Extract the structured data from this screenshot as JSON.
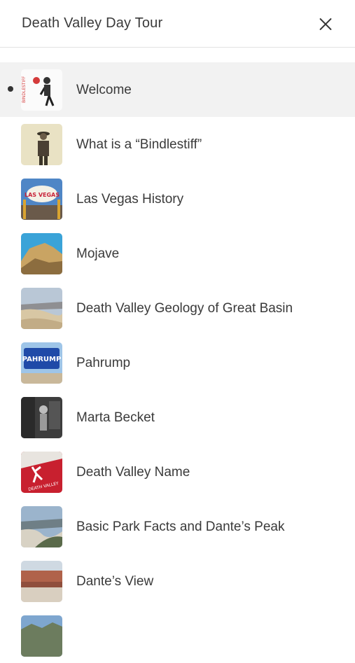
{
  "header": {
    "title": "Death Valley Day Tour"
  },
  "items": [
    {
      "label": "Welcome",
      "icon": "bindlestiff-hiker-thumbnail",
      "active": true
    },
    {
      "label": "What is a “Bindlestiff”",
      "icon": "bindlestiff-man-thumbnail"
    },
    {
      "label": "Las Vegas History",
      "icon": "las-vegas-sign-thumbnail"
    },
    {
      "label": "Mojave",
      "icon": "mojave-rocks-thumbnail"
    },
    {
      "label": "Death Valley Geology of Great Basin",
      "icon": "desert-dunes-thumbnail"
    },
    {
      "label": "Pahrump",
      "icon": "pahrump-sign-thumbnail"
    },
    {
      "label": "Marta Becket",
      "icon": "marta-becket-photo-thumbnail"
    },
    {
      "label": "Death Valley Name",
      "icon": "death-valley-logo-thumbnail"
    },
    {
      "label": "Basic Park Facts and Dante’s Peak",
      "icon": "dantes-peak-thumbnail"
    },
    {
      "label": "Dante’s View",
      "icon": "dantes-view-thumbnail"
    },
    {
      "label": "",
      "icon": "landscape-thumbnail"
    }
  ]
}
